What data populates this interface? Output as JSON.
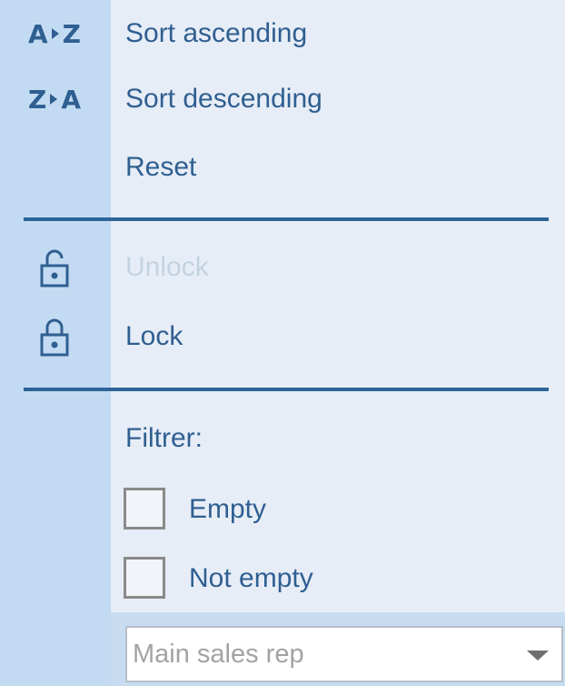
{
  "menu": {
    "items": [
      {
        "label": "Sort ascending",
        "icon": "sort-az-icon",
        "icon_text": [
          "A",
          "Z"
        ],
        "enabled": true
      },
      {
        "label": "Sort descending",
        "icon": "sort-za-icon",
        "icon_text": [
          "Z",
          "A"
        ],
        "enabled": true
      },
      {
        "label": "Reset",
        "icon": "",
        "enabled": true
      },
      {
        "label": "Unlock",
        "icon": "padlock-icon",
        "enabled": false
      },
      {
        "label": "Lock",
        "icon": "padlock-icon",
        "enabled": true
      }
    ]
  },
  "filter": {
    "title": "Filtrer:",
    "options": [
      {
        "label": "Empty",
        "checked": false
      },
      {
        "label": "Not empty",
        "checked": false
      }
    ],
    "select_placeholder": "Main sales rep"
  },
  "colors": {
    "accent": "#2f5f91",
    "divider": "#2c6498",
    "gutter": "#c3dbf2",
    "panel": "#e7edf6",
    "disabled_text": "#c4d2e0"
  }
}
